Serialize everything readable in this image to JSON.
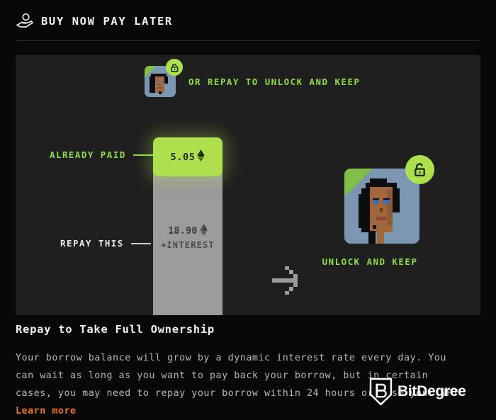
{
  "header": {
    "title": "BUY NOW PAY LATER",
    "icon": "hand-holding-coin-icon"
  },
  "panel": {
    "top_caption": "OR REPAY TO UNLOCK AND KEEP",
    "mini_avatar_name": "nft-avatar-small",
    "mini_lock_icon": "unlock-icon",
    "bar": {
      "paid_label": "ALREADY PAID",
      "paid_amount": "5.05",
      "paid_currency_icon": "ethereum-icon",
      "repay_label": "REPAY THIS",
      "repay_amount": "18.90",
      "repay_currency_icon": "ethereum-icon",
      "repay_sub": "+INTEREST"
    },
    "arrow_icon": "pixel-arrow-right-icon",
    "big_avatar_name": "nft-avatar-large",
    "big_lock_icon": "unlock-icon",
    "big_caption": "UNLOCK AND KEEP"
  },
  "body": {
    "title": "Repay to Take Full Ownership",
    "paragraph": "Your borrow balance will grow by a dynamic interest rate every day. You can wait as long as you want to pay back your borrow, but in certain cases, you may need to repay your borrow within 24 hours or lose your NFT. ",
    "link_label": "Learn more"
  },
  "watermark": {
    "brand": "BitDegree",
    "logo_icon": "bitdegree-shield-icon"
  },
  "colors": {
    "page_background": "#0a0707",
    "panel_background": "#1f1f1f",
    "accent_green": "#aee04d",
    "text_green": "#8ddb4a",
    "bar_gray": "#9b9b9b",
    "link_orange": "#e8742a",
    "avatar_bg_blue": "#7a96b0"
  }
}
